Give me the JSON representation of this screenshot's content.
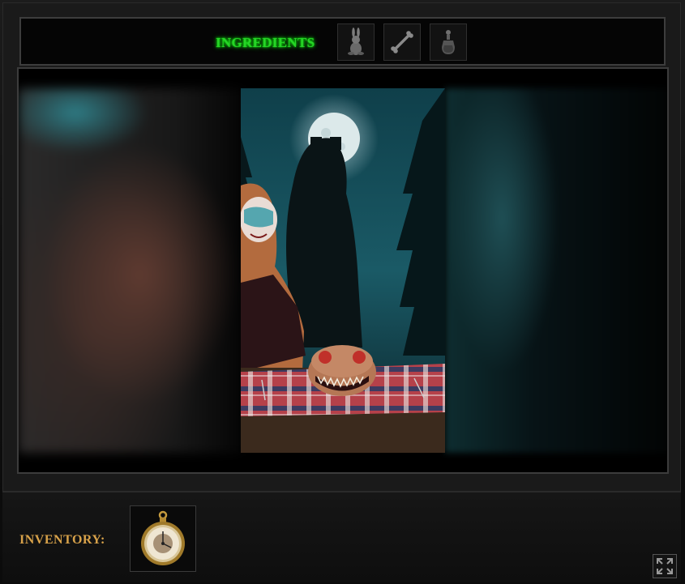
{
  "ingredients": {
    "label": "INGREDIENTS",
    "slots": [
      {
        "icon": "rabbit-icon"
      },
      {
        "icon": "bone-icon"
      },
      {
        "icon": "potion-bottle-icon"
      }
    ]
  },
  "scene": {
    "elements": [
      "full-moon",
      "pine-trees",
      "shadow-monster",
      "woman-with-face-paint",
      "creature-on-picnic-blanket"
    ]
  },
  "inventory": {
    "label": "INVENTORY:",
    "items": [
      {
        "icon": "pocket-watch-icon"
      }
    ]
  },
  "controls": {
    "fullscreen_icon": "fullscreen-icon"
  },
  "colors": {
    "ingredients_label": "#27d427",
    "inventory_label": "#d8a24a",
    "background": "#111111",
    "border": "#3c3c3c"
  }
}
